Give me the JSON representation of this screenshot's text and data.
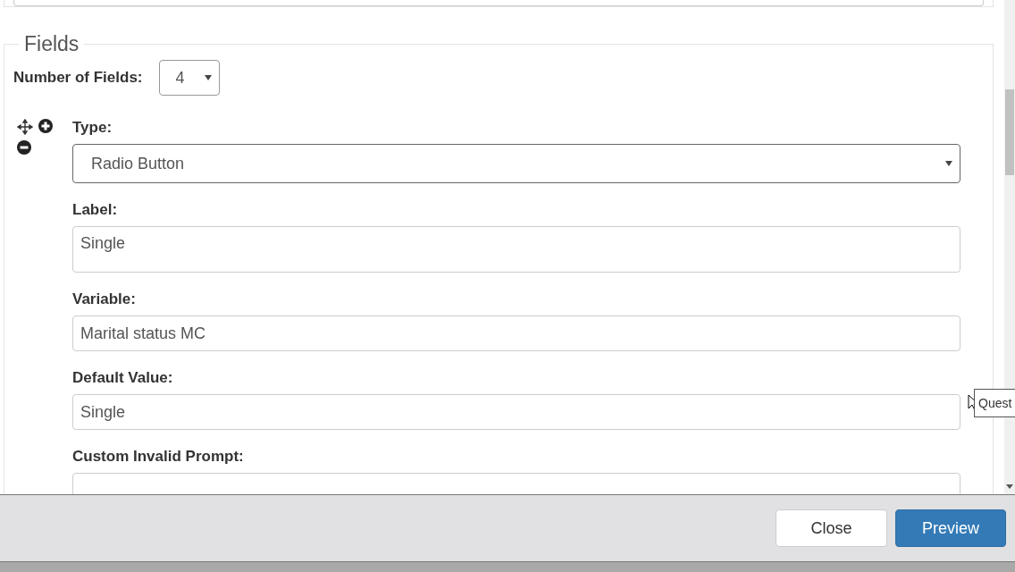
{
  "fieldset": {
    "legend": "Fields",
    "count_label": "Number of Fields:",
    "count_value": "4",
    "field": {
      "type_label": "Type:",
      "type_value": "Radio Button",
      "inputs": [
        {
          "label": "Label:",
          "value": "Single",
          "kind": "textarea"
        },
        {
          "label": "Variable:",
          "value": "Marital status MC",
          "kind": "text"
        },
        {
          "label": "Default Value:",
          "value": "Single",
          "kind": "text"
        },
        {
          "label": "Custom Invalid Prompt:",
          "kind": "text"
        }
      ]
    }
  },
  "tooltip": "Quest",
  "footer": {
    "buttons": [
      {
        "label": "Close",
        "kind": "default"
      },
      {
        "label": "Preview",
        "kind": "primary"
      }
    ]
  }
}
